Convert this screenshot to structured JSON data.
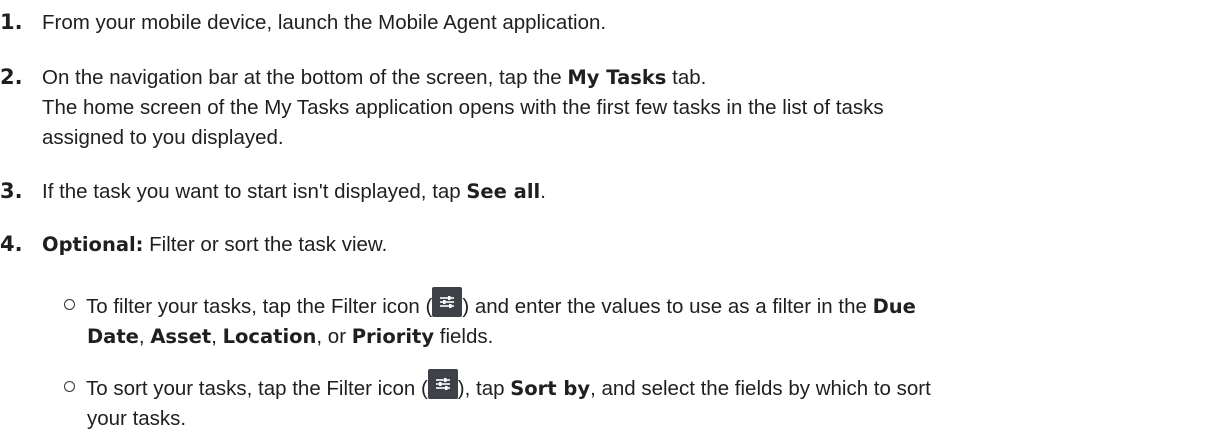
{
  "steps": [
    {
      "number": "1.",
      "text": "From your mobile device, launch the Mobile Agent application."
    },
    {
      "number": "2.",
      "text_before": "On the navigation bar at the bottom of the screen, tap the ",
      "bold": "My Tasks",
      "text_after": " tab.",
      "result_line1": "The home screen of the My Tasks application opens with the first few tasks in the list of tasks",
      "result_line2": "assigned to you displayed."
    },
    {
      "number": "3.",
      "text_before": "If the task you want to start isn't displayed, tap ",
      "bold": "See all",
      "text_after": "."
    },
    {
      "number": "4.",
      "bold": "Optional:",
      "text_after": " Filter or sort the task view.",
      "bullets": [
        {
          "part1": "To filter your tasks, tap the Filter icon (",
          "part2": ") and enter the values to use as a filter in the ",
          "bold1": "Due",
          "bold1b": "Date",
          "sep1": ", ",
          "bold2": "Asset",
          "sep2": ", ",
          "bold3": "Location",
          "sep3": ", or ",
          "bold4": "Priority",
          "end": " fields."
        },
        {
          "part1": "To sort your tasks, tap the Filter icon (",
          "part2": "), tap ",
          "bold1": "Sort by",
          "part3": ", and select the fields by which to sort",
          "line2": "your tasks."
        }
      ]
    }
  ],
  "icons": {
    "filter": "filter-icon"
  }
}
